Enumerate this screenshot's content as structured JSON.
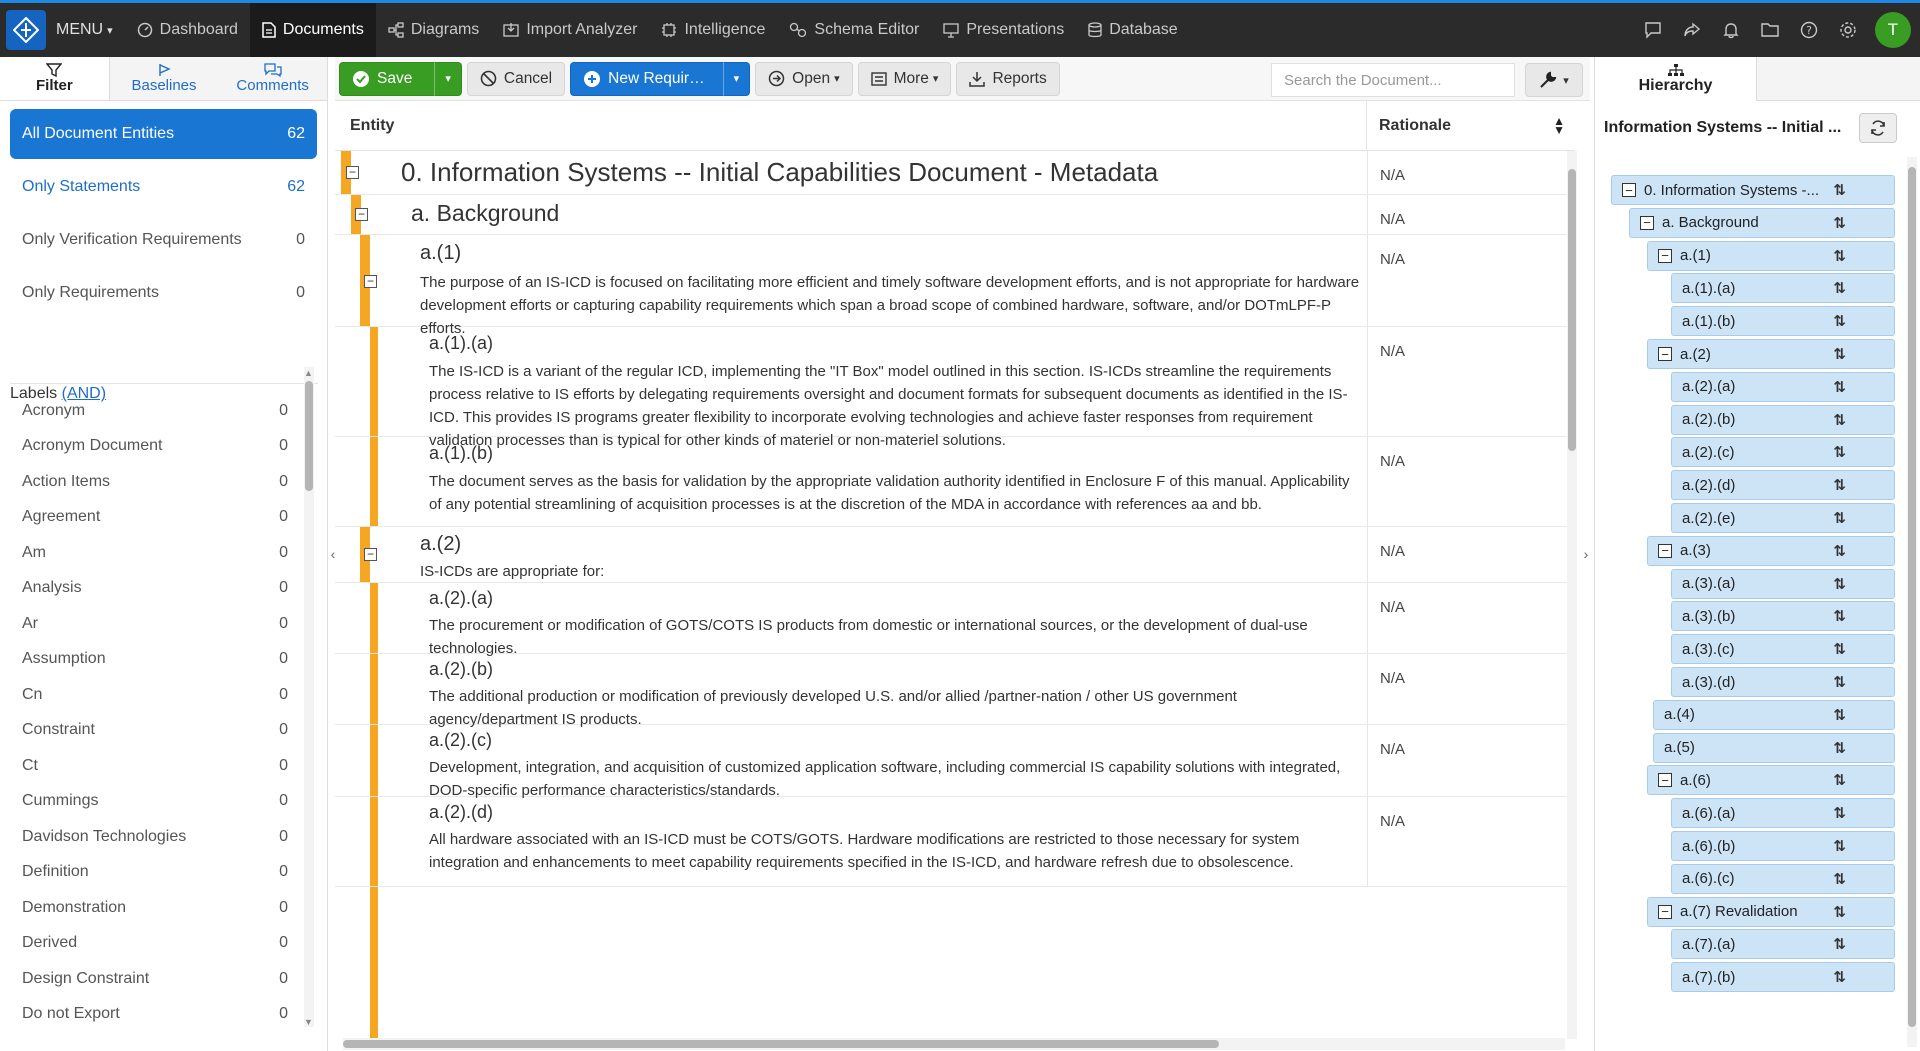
{
  "nav": {
    "menu": "MENU",
    "items": [
      "Dashboard",
      "Documents",
      "Diagrams",
      "Import Analyzer",
      "Intelligence",
      "Schema Editor",
      "Presentations",
      "Database"
    ],
    "avatar": "T"
  },
  "left": {
    "tabs": [
      "Filter",
      "Baselines",
      "Comments"
    ],
    "filters": [
      {
        "label": "All Document Entities",
        "count": "62"
      },
      {
        "label": "Only Statements",
        "count": "62"
      },
      {
        "label": "Only Verification Requirements",
        "count": "0"
      },
      {
        "label": "Only Requirements",
        "count": "0"
      }
    ],
    "labels_title": "Labels",
    "labels_mode": "(AND)",
    "labels": [
      {
        "name": "Acronym",
        "count": "0"
      },
      {
        "name": "Acronym Document",
        "count": "0"
      },
      {
        "name": "Action Items",
        "count": "0"
      },
      {
        "name": "Agreement",
        "count": "0"
      },
      {
        "name": "Am",
        "count": "0"
      },
      {
        "name": "Analysis",
        "count": "0"
      },
      {
        "name": "Ar",
        "count": "0"
      },
      {
        "name": "Assumption",
        "count": "0"
      },
      {
        "name": "Cn",
        "count": "0"
      },
      {
        "name": "Constraint",
        "count": "0"
      },
      {
        "name": "Ct",
        "count": "0"
      },
      {
        "name": "Cummings",
        "count": "0"
      },
      {
        "name": "Davidson Technologies",
        "count": "0"
      },
      {
        "name": "Definition",
        "count": "0"
      },
      {
        "name": "Demonstration",
        "count": "0"
      },
      {
        "name": "Derived",
        "count": "0"
      },
      {
        "name": "Design Constraint",
        "count": "0"
      },
      {
        "name": "Do not Export",
        "count": "0"
      }
    ]
  },
  "toolbar": {
    "save": "Save",
    "cancel": "Cancel",
    "new_req": "New Requir…",
    "open": "Open",
    "more": "More",
    "reports": "Reports",
    "search_placeholder": "Search the Document..."
  },
  "table": {
    "col_entity": "Entity",
    "col_rationale": "Rationale",
    "rows": [
      {
        "heading": "0. Information Systems -- Initial Capabilities Document - Metadata",
        "body": "",
        "rationale": "N/A"
      },
      {
        "heading": "a. Background",
        "body": "",
        "rationale": "N/A"
      },
      {
        "heading": "a.(1)",
        "body": "The purpose of an IS-ICD is focused on facilitating more efficient and timely software development efforts, and is not appropriate for hardware development efforts or capturing capability requirements which span a broad scope of combined hardware, software, and/or DOTmLPF-P efforts.",
        "rationale": "N/A"
      },
      {
        "heading": "a.(1).(a)",
        "body": "The IS-ICD is a variant of the regular ICD, implementing the \"IT Box\" model outlined in this section. IS-ICDs streamline the requirements process relative to IS efforts by delegating requirements oversight and document formats for subsequent documents as identified in the IS-ICD. This provides IS programs greater flexibility to incorporate evolving technologies and achieve faster responses from requirement validation processes than is typical for other kinds of materiel or non-materiel solutions.",
        "rationale": "N/A"
      },
      {
        "heading": "a.(1).(b)",
        "body": "The document serves as the basis for validation by the appropriate validation authority identified in Enclosure F of this manual. Applicability of any potential streamlining of acquisition processes is at the discretion of the MDA in accordance with references aa and bb.",
        "rationale": "N/A"
      },
      {
        "heading": "a.(2)",
        "body": "IS-ICDs are appropriate for:",
        "rationale": "N/A"
      },
      {
        "heading": "a.(2).(a)",
        "body": "The procurement or modification of GOTS/COTS IS products from domestic or international sources, or the development of dual-use technologies.",
        "rationale": "N/A"
      },
      {
        "heading": "a.(2).(b)",
        "body": "The additional production or modification of previously developed U.S. and/or allied /partner-nation / other US government agency/department IS products.",
        "rationale": "N/A"
      },
      {
        "heading": "a.(2).(c)",
        "body": "Development, integration, and acquisition of customized application software, including commercial IS capability solutions with integrated, DOD-specific performance characteristics/standards.",
        "rationale": "N/A"
      },
      {
        "heading": "a.(2).(d)",
        "body": "All hardware associated with an IS-ICD must be COTS/GOTS. Hardware modifications are restricted to those necessary for system integration and enhancements to meet capability requirements specified in the IS-ICD, and hardware refresh due to obsolescence.",
        "rationale": "N/A"
      }
    ]
  },
  "right": {
    "tab": "Hierarchy",
    "title": "Information Systems -- Initial ...",
    "tree": [
      {
        "label": "0. Information Systems -...",
        "toggle": "⊟",
        "level": 0
      },
      {
        "label": "a. Background",
        "toggle": "⊟",
        "level": 1
      },
      {
        "label": "a.(1)",
        "toggle": "⊟",
        "level": 2
      },
      {
        "label": "a.(1).(a)",
        "toggle": "",
        "level": 3
      },
      {
        "label": "a.(1).(b)",
        "toggle": "",
        "level": 3
      },
      {
        "label": "a.(2)",
        "toggle": "⊟",
        "level": 2
      },
      {
        "label": "a.(2).(a)",
        "toggle": "",
        "level": 3
      },
      {
        "label": "a.(2).(b)",
        "toggle": "",
        "level": 3
      },
      {
        "label": "a.(2).(c)",
        "toggle": "",
        "level": 3
      },
      {
        "label": "a.(2).(d)",
        "toggle": "",
        "level": 3
      },
      {
        "label": "a.(2).(e)",
        "toggle": "",
        "level": 3
      },
      {
        "label": "a.(3)",
        "toggle": "⊟",
        "level": 2
      },
      {
        "label": "a.(3).(a)",
        "toggle": "",
        "level": 3
      },
      {
        "label": "a.(3).(b)",
        "toggle": "",
        "level": 3
      },
      {
        "label": "a.(3).(c)",
        "toggle": "",
        "level": 3
      },
      {
        "label": "a.(3).(d)",
        "toggle": "",
        "level": 3
      },
      {
        "label": "a.(4)",
        "toggle": "",
        "level": 2
      },
      {
        "label": "a.(5)",
        "toggle": "",
        "level": 2
      },
      {
        "label": "a.(6)",
        "toggle": "⊟",
        "level": 2
      },
      {
        "label": "a.(6).(a)",
        "toggle": "",
        "level": 3
      },
      {
        "label": "a.(6).(b)",
        "toggle": "",
        "level": 3
      },
      {
        "label": "a.(6).(c)",
        "toggle": "",
        "level": 3
      },
      {
        "label": "a.(7) Revalidation",
        "toggle": "⊟",
        "level": 2
      },
      {
        "label": "a.(7).(a)",
        "toggle": "",
        "level": 3
      },
      {
        "label": "a.(7).(b)",
        "toggle": "",
        "level": 3
      }
    ]
  },
  "colors": {
    "accent": "#1976d2",
    "save": "#3a9d23",
    "bar": "#f5a623",
    "tree": "#cde4f7"
  }
}
